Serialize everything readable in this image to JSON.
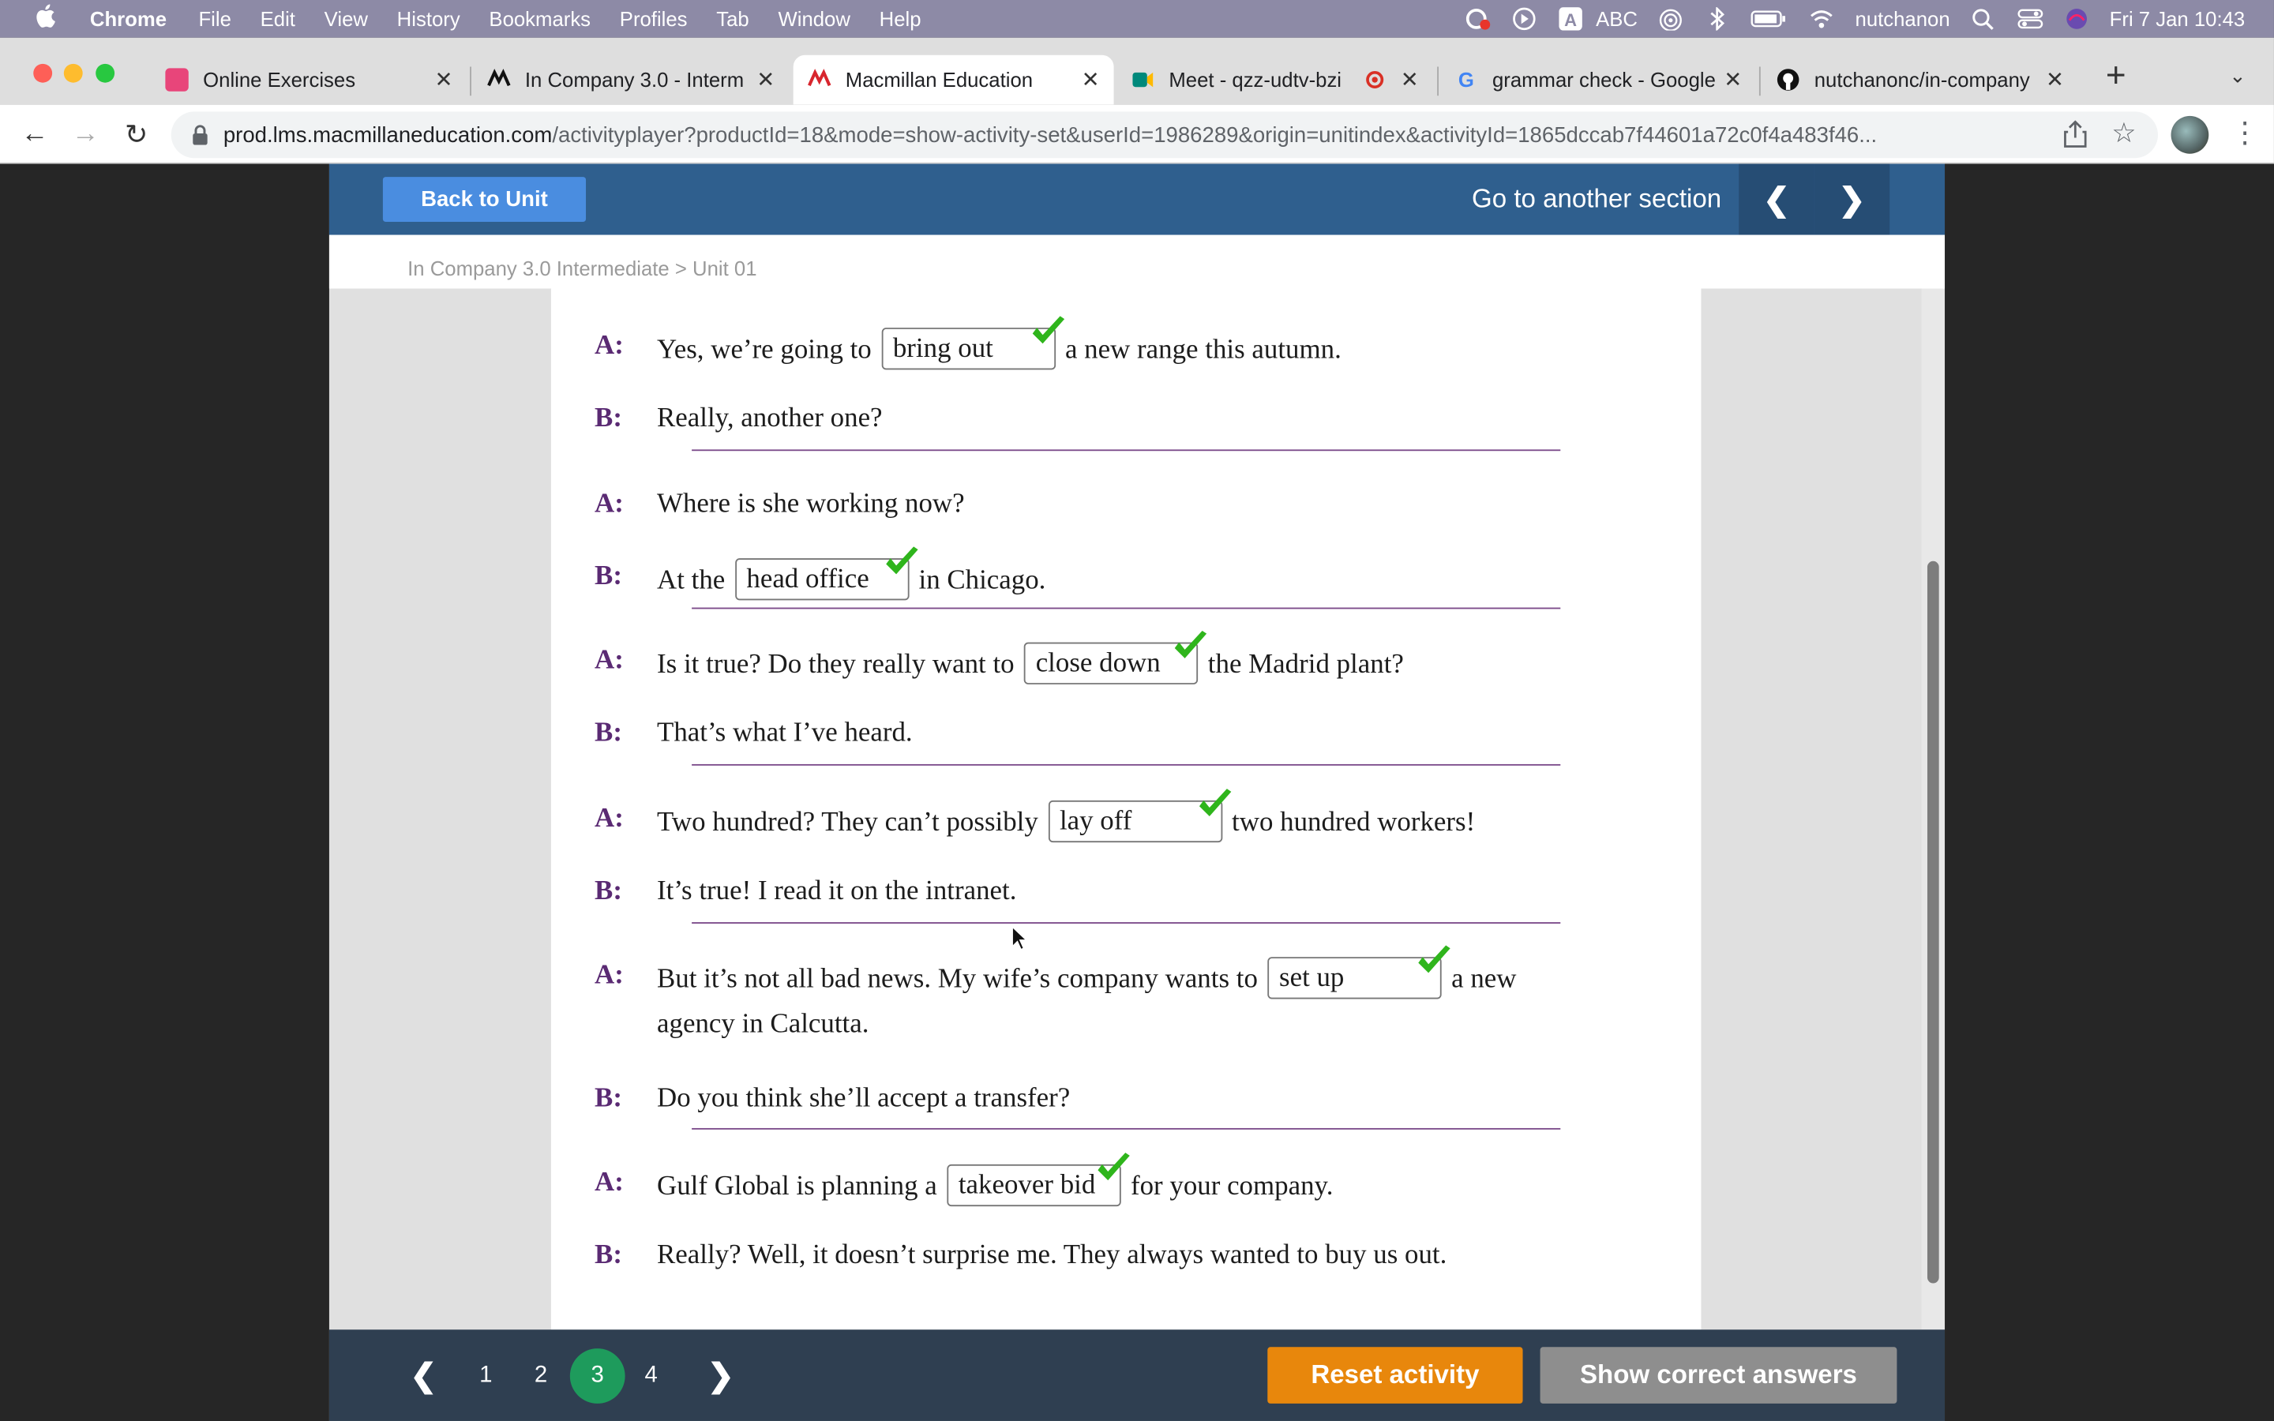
{
  "menubar": {
    "app": "Chrome",
    "items": [
      "File",
      "Edit",
      "View",
      "History",
      "Bookmarks",
      "Profiles",
      "Tab",
      "Window",
      "Help"
    ],
    "input_source": "ABC",
    "user": "nutchanon",
    "datetime": "Fri 7 Jan  10:43"
  },
  "tabs": [
    {
      "title": "Online Exercises",
      "icon": "online-exercises-favicon",
      "color": "#e8457a"
    },
    {
      "title": "In Company 3.0 - Interm",
      "icon": "macmillan-favicon",
      "color": "#111111"
    },
    {
      "title": "Macmillan Education",
      "icon": "macmillan-favicon",
      "color": "#d8262e"
    },
    {
      "title": "Meet - qzz-udtv-bzi",
      "icon": "meet-favicon",
      "color": "#00897b"
    },
    {
      "title": "grammar check - Google",
      "icon": "google-favicon",
      "color": "#4285f4"
    },
    {
      "title": "nutchanonc/in-company",
      "icon": "github-favicon",
      "color": "#111111"
    }
  ],
  "address": {
    "host": "prod.lms.macmillaneducation.com",
    "path": "/activityplayer?productId=18&mode=show-activity-set&userId=1986289&origin=unitindex&activityId=1865dccab7f44601a72c0f4a483f46..."
  },
  "header": {
    "back_label": "Back to Unit",
    "goto_label": "Go to another section",
    "prev": "❮",
    "next": "❯"
  },
  "breadcrumb": "In Company 3.0 Intermediate  >  Unit 01",
  "dialogue": [
    {
      "speaker": "A:",
      "before": "Yes, we’re going to",
      "answer": "bring out",
      "after": "a new range this autumn."
    },
    {
      "speaker": "B:",
      "text": "Really, another one?"
    },
    {
      "speaker": "A:",
      "text": "Where is she working now?"
    },
    {
      "speaker": "B:",
      "before": "At the",
      "answer": "head office",
      "after": "in Chicago."
    },
    {
      "speaker": "A:",
      "before": "Is it true? Do they really want to",
      "answer": "close down",
      "after": "the Madrid plant?"
    },
    {
      "speaker": "B:",
      "text": "That’s what I’ve heard."
    },
    {
      "speaker": "A:",
      "before": "Two hundred? They can’t possibly",
      "answer": "lay off",
      "after": "two hundred workers!"
    },
    {
      "speaker": "B:",
      "text": "It’s true! I read it on the intranet."
    },
    {
      "speaker": "A:",
      "before": "But it’s not all bad news. My wife’s company wants to",
      "answer": "set up",
      "after": "a new",
      "cont": "agency in Calcutta."
    },
    {
      "speaker": "B:",
      "text": "Do you think she’ll accept a transfer?"
    },
    {
      "speaker": "A:",
      "before": "Gulf Global is planning a",
      "answer": "takeover bid",
      "after": "for your company."
    },
    {
      "speaker": "B:",
      "text": "Really? Well, it doesn’t surprise me. They always wanted to buy us out."
    }
  ],
  "pagination": {
    "pages": [
      "1",
      "2",
      "3",
      "4"
    ],
    "current": "3",
    "prev": "❮",
    "next": "❯"
  },
  "actions": {
    "reset": "Reset activity",
    "show_answers": "Show correct answers"
  },
  "colors": {
    "accent_blue": "#2f5f8e",
    "orange": "#e8870c",
    "green": "#1e9b5c",
    "tick": "#2fb51c"
  }
}
